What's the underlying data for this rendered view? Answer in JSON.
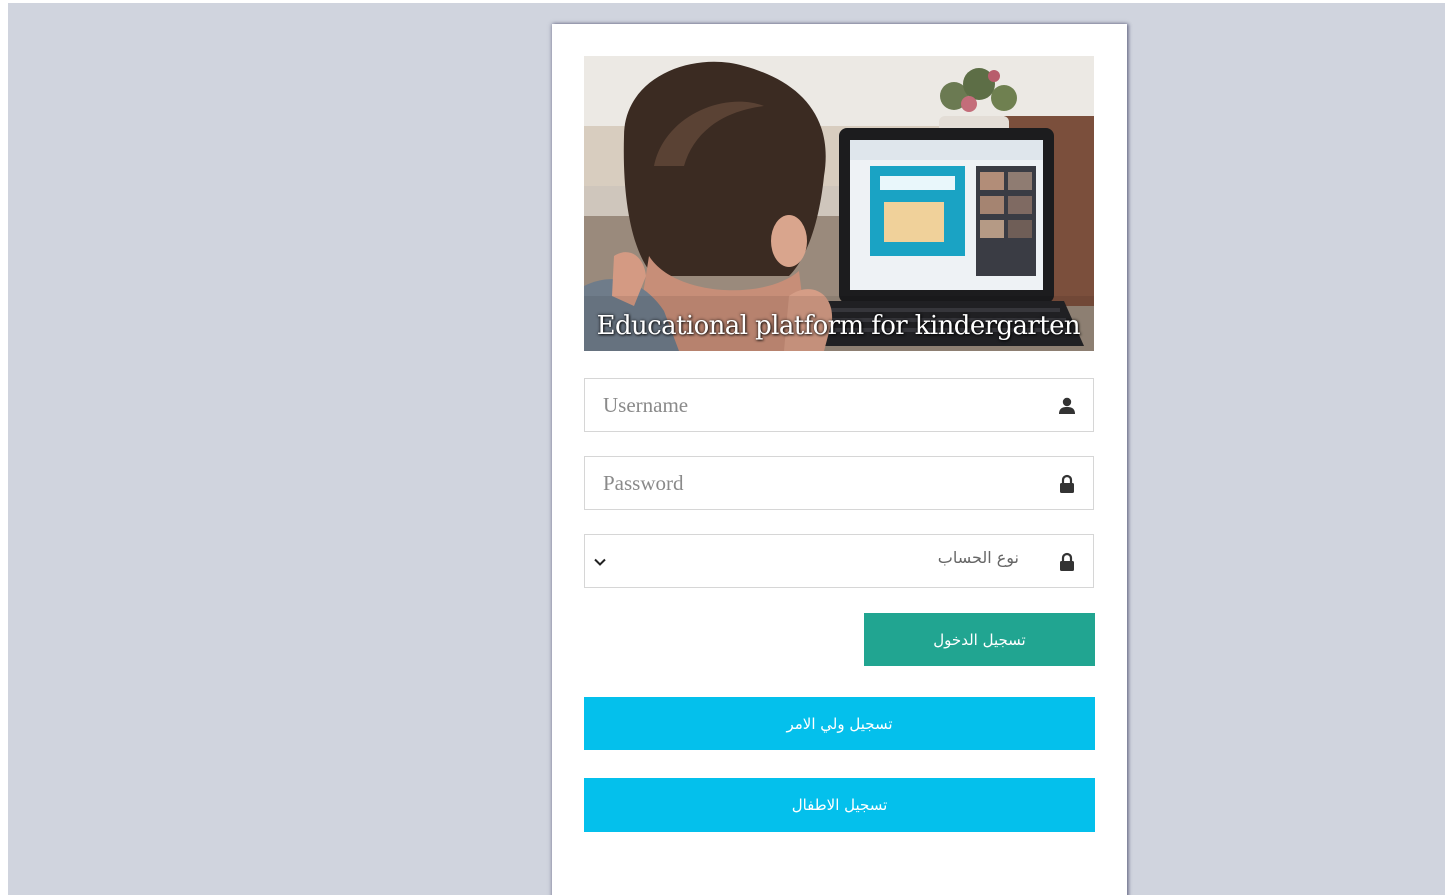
{
  "hero": {
    "caption": "Educational platform for kindergarten"
  },
  "form": {
    "username_placeholder": "Username",
    "password_placeholder": "Password",
    "account_type_label": "نوع الحساب",
    "login_label": "تسجيل الدخول",
    "register_parent_label": "تسجيل ولي الامر",
    "register_children_label": "تسجيل الاطفال"
  },
  "icons": {
    "username": "user-icon",
    "password": "lock-icon",
    "account_type": "lock-icon",
    "dropdown": "chevron-down-icon"
  },
  "colors": {
    "page_background": "#d0d4de",
    "login_button": "#21a591",
    "register_buttons": "#04c0ec"
  }
}
